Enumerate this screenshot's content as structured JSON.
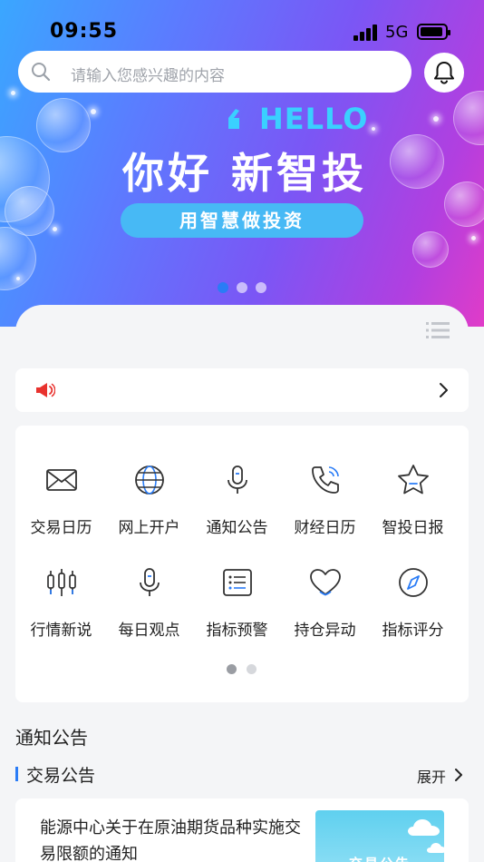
{
  "status_bar": {
    "time": "09:55",
    "network": "5G"
  },
  "search": {
    "placeholder": "请输入您感兴趣的内容"
  },
  "banner": {
    "hello": "HELLO",
    "headline": "你好  新智投",
    "button_label": "用智慧做投资",
    "pager": {
      "count": 3,
      "active_index": 0
    }
  },
  "colors": {
    "accent": "#2a7cf6",
    "banner_pill": "#47b9f5",
    "hello": "#3ad0ff",
    "notice_icon": "#e8322e"
  },
  "quick_menu": {
    "items": [
      {
        "label": "交易日历",
        "icon": "envelope-icon"
      },
      {
        "label": "网上开户",
        "icon": "globe-icon"
      },
      {
        "label": "通知公告",
        "icon": "microphone-icon"
      },
      {
        "label": "财经日历",
        "icon": "phone-icon"
      },
      {
        "label": "智投日报",
        "icon": "star-icon"
      },
      {
        "label": "行情新说",
        "icon": "candlestick-icon"
      },
      {
        "label": "每日观点",
        "icon": "microphone-icon"
      },
      {
        "label": "指标预警",
        "icon": "list-card-icon"
      },
      {
        "label": "持仓异动",
        "icon": "heart-icon"
      },
      {
        "label": "指标评分",
        "icon": "compass-icon"
      }
    ],
    "pager": {
      "count": 2,
      "active_index": 0
    }
  },
  "announcements": {
    "section_title": "通知公告",
    "sub_title": "交易公告",
    "expand_label": "展开",
    "items": [
      {
        "title": "能源中心关于在原油期货品种实施交易限额的通知",
        "thumb_label": "交易公告"
      }
    ]
  }
}
